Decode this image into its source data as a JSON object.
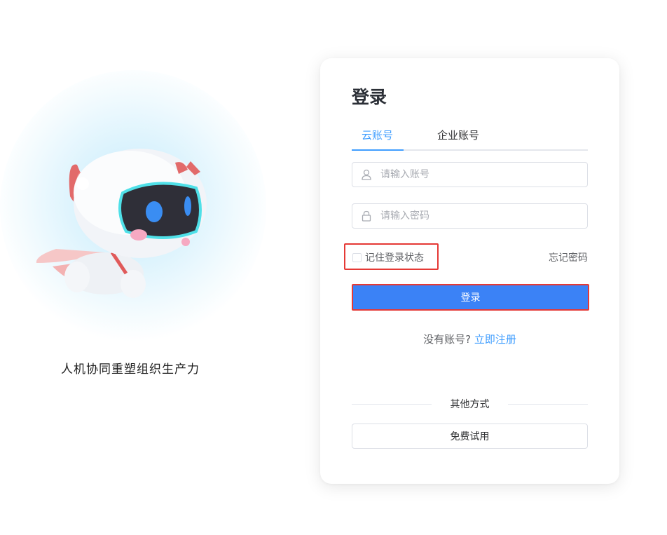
{
  "hero": {
    "tagline": "人机协同重塑组织生产力",
    "illustration": "robot-mascot"
  },
  "login": {
    "title": "登录",
    "tabs": [
      {
        "label": "云账号",
        "active": true
      },
      {
        "label": "企业账号",
        "active": false
      }
    ],
    "username": {
      "placeholder": "请输入账号",
      "value": "",
      "icon": "user-icon"
    },
    "password": {
      "placeholder": "请输入密码",
      "value": "",
      "icon": "lock-icon"
    },
    "remember": {
      "label": "记住登录状态",
      "checked": false
    },
    "forgot_label": "忘记密码",
    "submit_label": "登录",
    "register": {
      "prompt": "没有账号?",
      "link": "立即注册"
    },
    "other_methods_label": "其他方式",
    "trial_label": "免费试用"
  },
  "colors": {
    "primary": "#3b82f6",
    "link": "#409eff",
    "highlight_border": "#e53935"
  }
}
